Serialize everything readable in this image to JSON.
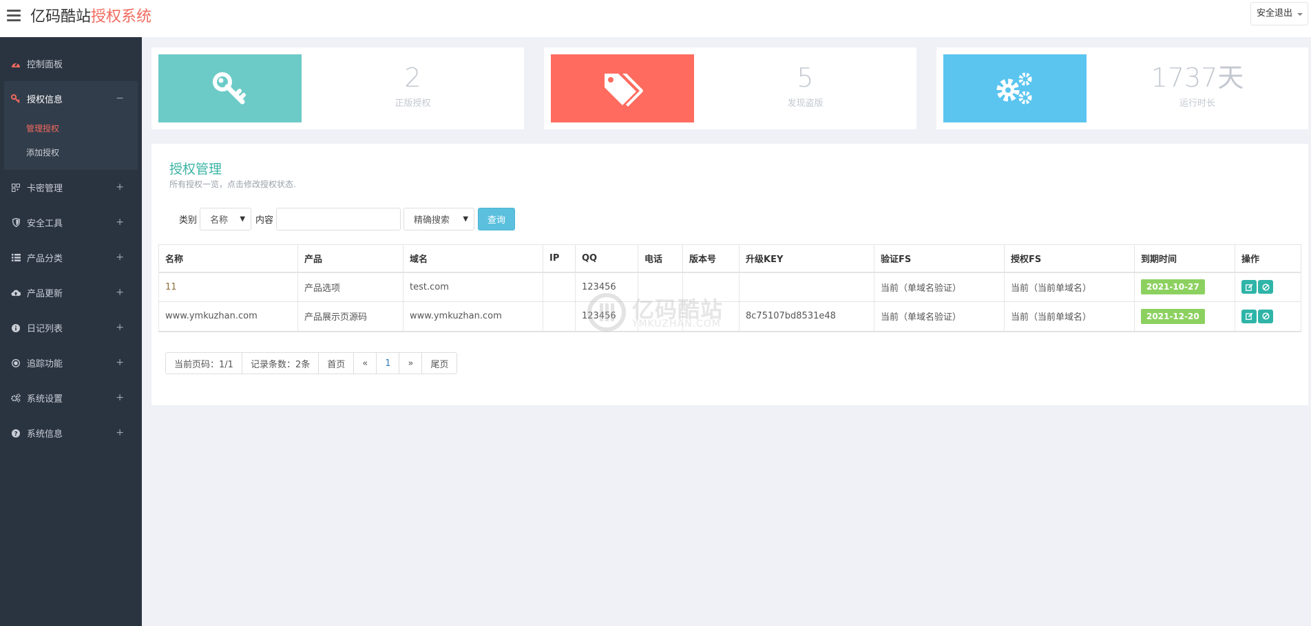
{
  "header": {
    "brand_main": "亿码酷站",
    "brand_accent": "授权系统",
    "logout": "安全退出"
  },
  "sidebar": {
    "items": [
      {
        "label": "控制面板",
        "icon": "dashboard-icon"
      },
      {
        "label": "授权信息",
        "icon": "key-icon",
        "expanded": true,
        "toggle": "−",
        "children": [
          {
            "label": "管理授权",
            "active": true
          },
          {
            "label": "添加授权"
          }
        ]
      },
      {
        "label": "卡密管理",
        "icon": "qrcode-icon",
        "toggle": "+"
      },
      {
        "label": "安全工具",
        "icon": "shield-icon",
        "toggle": "+"
      },
      {
        "label": "产品分类",
        "icon": "list-icon",
        "toggle": "+"
      },
      {
        "label": "产品更新",
        "icon": "cloud-upload-icon",
        "toggle": "+"
      },
      {
        "label": "日记列表",
        "icon": "info-icon",
        "toggle": "+"
      },
      {
        "label": "追踪功能",
        "icon": "target-icon",
        "toggle": "+"
      },
      {
        "label": "系统设置",
        "icon": "gears-icon",
        "toggle": "+"
      },
      {
        "label": "系统信息",
        "icon": "question-icon",
        "toggle": "+"
      }
    ]
  },
  "stats": [
    {
      "value": "2",
      "label": "正版授权",
      "color": "#6ccbc7",
      "icon": "key-icon"
    },
    {
      "value": "5",
      "label": "发现盗版",
      "color": "#ff6b5f",
      "icon": "tags-icon"
    },
    {
      "value": "1737天",
      "label": "运行时长",
      "color": "#5bc5f0",
      "icon": "gears-icon"
    }
  ],
  "panel": {
    "title": "授权管理",
    "subtitle": "所有授权一览，点击修改授权状态."
  },
  "search": {
    "category_label": "类别",
    "category_value": "名称",
    "content_label": "内容",
    "content_value": "",
    "mode_value": "精确搜索",
    "query_button": "查询"
  },
  "table": {
    "columns": [
      "名称",
      "产品",
      "域名",
      "IP",
      "QQ",
      "电话",
      "版本号",
      "升级KEY",
      "验证FS",
      "授权FS",
      "到期时间",
      "操作"
    ],
    "rows": [
      {
        "name": "11",
        "product": "产品选项",
        "domain": "test.com",
        "ip": "",
        "qq": "123456",
        "phone": "",
        "version": "",
        "key": "",
        "verify_fs": "当前（单域名验证）",
        "auth_fs": "当前（当前单域名）",
        "expire": "2021-10-27"
      },
      {
        "name": "www.ymkuzhan.com",
        "product": "产品展示页源码",
        "domain": "www.ymkuzhan.com",
        "ip": "",
        "qq": "123456",
        "phone": "",
        "version": "",
        "key": "8c75107bd8531e48",
        "verify_fs": "当前（单域名验证）",
        "auth_fs": "当前（当前单域名）",
        "expire": "2021-12-20"
      }
    ]
  },
  "pager": {
    "current": "当前页码：1/1",
    "records": "记录条数：2条",
    "first": "首页",
    "prev": "«",
    "page": "1",
    "next": "»",
    "last": "尾页"
  },
  "watermark": {
    "title": "亿码酷站",
    "sub": "YMKUZHAN.COM"
  }
}
